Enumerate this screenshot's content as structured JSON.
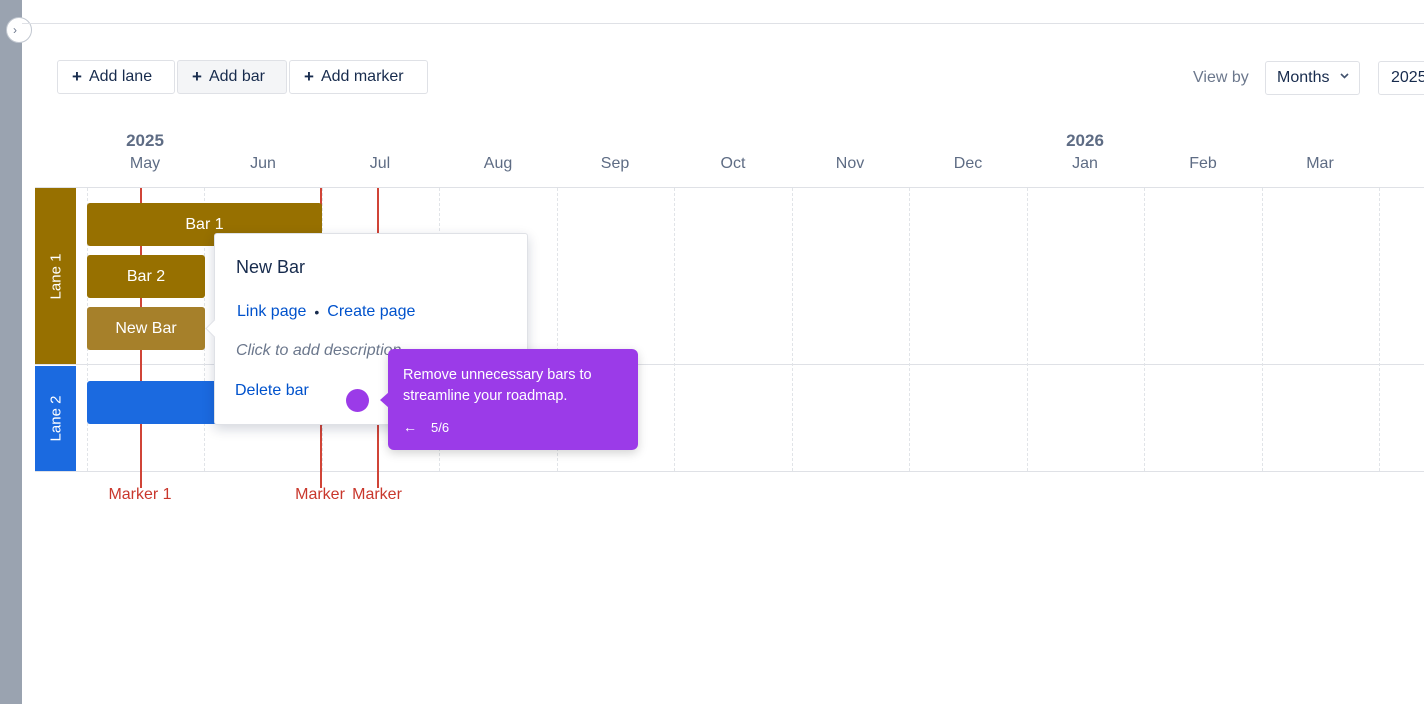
{
  "toolbar": {
    "add_lane": "Add lane",
    "add_bar": "Add bar",
    "add_marker": "Add marker"
  },
  "view_by": {
    "label": "View by",
    "selected": "Months",
    "year": "2025"
  },
  "timeline": {
    "years": [
      "2025",
      "2026"
    ],
    "months": [
      "May",
      "Jun",
      "Jul",
      "Aug",
      "Sep",
      "Oct",
      "Nov",
      "Dec",
      "Jan",
      "Feb",
      "Mar"
    ]
  },
  "lanes": [
    {
      "label": "Lane 1",
      "color": "#977000"
    },
    {
      "label": "Lane 2",
      "color": "#1b6ae0"
    }
  ],
  "bars": [
    {
      "label": "Bar 1",
      "color": "#977000"
    },
    {
      "label": "Bar 2",
      "color": "#977000"
    },
    {
      "label": "New Bar",
      "color": "#a6802a"
    },
    {
      "label": "",
      "color": "#1b6ae0"
    }
  ],
  "markers": [
    {
      "label": "Marker 1",
      "color": "#d04437"
    },
    {
      "label": "Marker",
      "color": "#d04437"
    },
    {
      "label": "Marker",
      "color": "#d04437"
    }
  ],
  "popover": {
    "title": "New Bar",
    "link_page": "Link page",
    "separator": "•",
    "create_page": "Create page",
    "description_placeholder": "Click to add description",
    "delete": "Delete bar"
  },
  "tooltip": {
    "text": "Remove unnecessary bars to streamline your roadmap.",
    "back_icon": "←",
    "step": "5/6",
    "color": "#9b3be8"
  }
}
